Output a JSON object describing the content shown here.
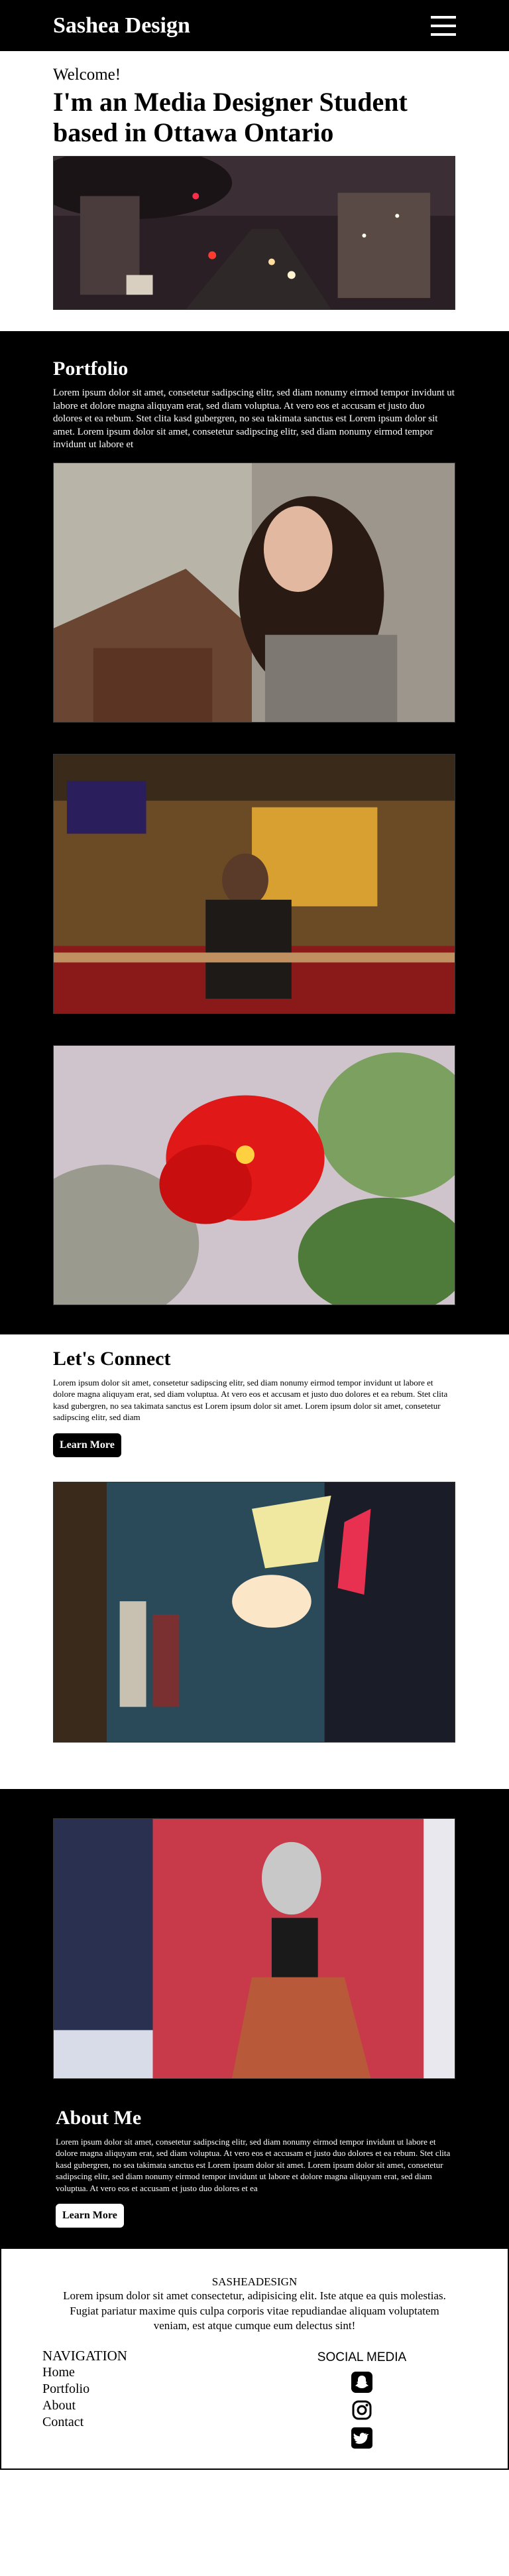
{
  "header": {
    "logo": "Sashea Design",
    "menu_icon": "hamburger-menu-icon"
  },
  "hero": {
    "welcome": "Welcome!",
    "tagline": "I'm an Media Designer Student based in Ottawa Ontario",
    "image": "city-street-night-photo"
  },
  "portfolio": {
    "title": "Portfolio",
    "text": "Lorem ipsum dolor sit amet, consetetur sadipscing elitr, sed diam nonumy eirmod tempor invidunt ut labore et dolore magna aliquyam erat, sed diam voluptua. At vero eos et accusam et justo duo dolores et ea rebum. Stet clita kasd gubergren, no sea takimata sanctus est Lorem ipsum dolor sit amet. Lorem ipsum dolor sit amet, consetetur sadipscing elitr, sed diam nonumy eirmod tempor invidunt ut labore et",
    "images": [
      "woman-portrait-photo",
      "bar-interior-photo",
      "red-hibiscus-flower-photo"
    ]
  },
  "connect": {
    "title": "Let's Connect",
    "text": "Lorem ipsum dolor sit amet, consetetur sadipscing elitr, sed diam nonumy eirmod tempor invidunt ut labore et dolore magna aliquyam erat, sed diam voluptua. At vero eos et accusam et justo duo dolores et ea rebum. Stet clita kasd gubergren, no sea takimata sanctus est Lorem ipsum dolor sit amet. Lorem ipsum dolor sit amet, consetetur sadipscing elitr, sed diam",
    "button": "Learn More",
    "image": "lamps-still-life-photo"
  },
  "about": {
    "image": "street-mural-photo",
    "title": "About Me",
    "text": "Lorem ipsum dolor sit amet, consetetur sadipscing elitr, sed diam nonumy eirmod tempor invidunt ut labore et dolore magna aliquyam erat, sed diam voluptua. At vero eos et accusam et justo duo dolores et ea rebum. Stet clita kasd gubergren, no sea takimata sanctus est Lorem ipsum dolor sit amet. Lorem ipsum dolor sit amet, consetetur sadipscing elitr, sed diam nonumy eirmod tempor invidunt ut labore et dolore magna aliquyam erat, sed diam voluptua. At vero eos et accusam et justo duo dolores et ea",
    "button": "Learn More"
  },
  "footer": {
    "brand": "SASHEADESIGN",
    "text": "Lorem ipsum dolor sit amet consectetur, adipisicing elit. Iste atque ea quis molestias. Fugiat pariatur maxime quis culpa corporis vitae repudiandae aliquam voluptatem veniam, est atque cumque eum delectus sint!",
    "nav_title": "NAVIGATION",
    "nav": [
      "Home",
      "Portfolio",
      "About",
      "Contact"
    ],
    "social_title": "SOCIAL MEDIA",
    "social_icons": [
      "snapchat-icon",
      "instagram-icon",
      "twitter-icon"
    ]
  }
}
